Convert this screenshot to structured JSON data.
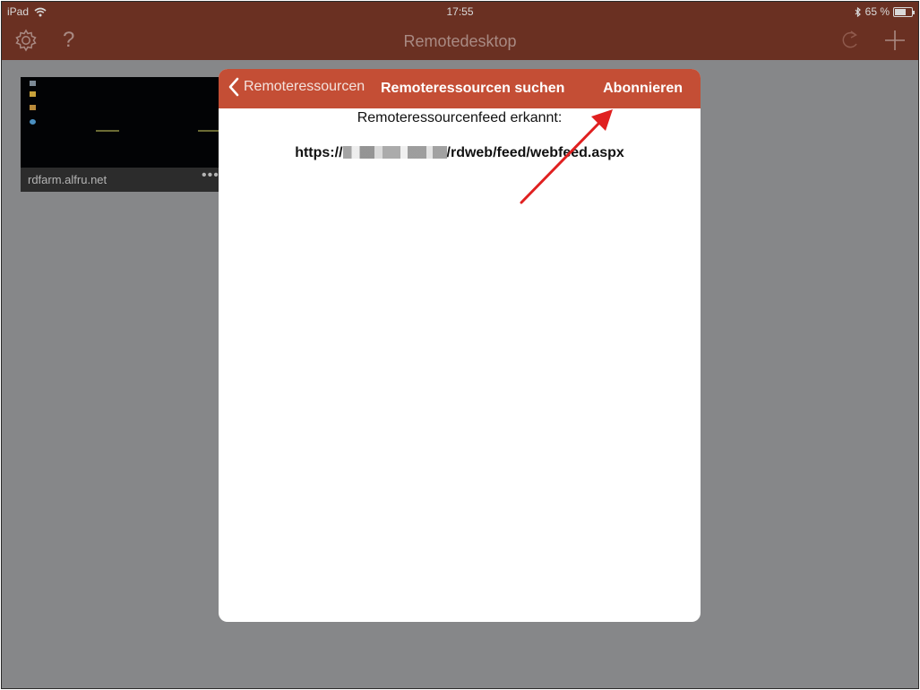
{
  "status_bar": {
    "device": "iPad",
    "time": "17:55",
    "battery_text": "65 %",
    "battery_level": 0.65
  },
  "nav": {
    "title": "Remotedesktop",
    "left_icons": [
      "gear-icon",
      "help-icon"
    ],
    "right_icons": [
      "refresh-icon",
      "add-icon"
    ]
  },
  "desktop_thumbnail": {
    "label": "rdfarm.alfru.net",
    "more": "•••"
  },
  "modal": {
    "back_label": "Remoteressourcen",
    "title": "Remoteressourcen suchen",
    "action_label": "Abonnieren",
    "detected_label": "Remoteressourcenfeed erkannt:",
    "url_prefix": "https://",
    "url_suffix": "/rdweb/feed/webfeed.aspx"
  },
  "colors": {
    "header_bar": "#6a3022",
    "modal_header": "#c44e35",
    "overlay": "#868789",
    "arrow": "#e02020"
  }
}
